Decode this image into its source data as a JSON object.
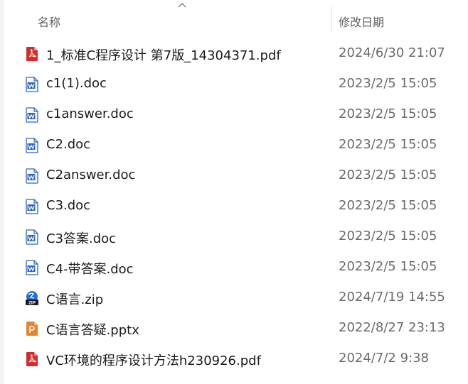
{
  "header": {
    "name_label": "名称",
    "date_label": "修改日期"
  },
  "colors": {
    "pdf": "#d42b2b",
    "doc": "#2b65c8",
    "ppt": "#e8832b",
    "zip": "#1e6fd0"
  },
  "files": [
    {
      "name": "1_标准C程序设计 第7版_14304371.pdf",
      "date": "2024/6/30 21:07",
      "icon": "pdf-icon"
    },
    {
      "name": "c1(1).doc",
      "date": "2023/2/5 15:05",
      "icon": "word-doc-icon"
    },
    {
      "name": "c1answer.doc",
      "date": "2023/2/5 15:05",
      "icon": "word-doc-icon"
    },
    {
      "name": "C2.doc",
      "date": "2023/2/5 15:05",
      "icon": "word-doc-icon"
    },
    {
      "name": "C2answer.doc",
      "date": "2023/2/5 15:05",
      "icon": "word-doc-icon"
    },
    {
      "name": "C3.doc",
      "date": "2023/2/5 15:05",
      "icon": "word-doc-icon"
    },
    {
      "name": "C3答案.doc",
      "date": "2023/2/5 15:05",
      "icon": "word-doc-icon"
    },
    {
      "name": "C4-带答案.doc",
      "date": "2023/2/5 15:05",
      "icon": "word-doc-icon"
    },
    {
      "name": "C语言.zip",
      "date": "2024/7/19 14:55",
      "icon": "zip-icon",
      "icon_text": "ZIP"
    },
    {
      "name": "C语言答疑.pptx",
      "date": "2022/8/27 23:13",
      "icon": "pptx-icon"
    },
    {
      "name": "VC环境的程序设计方法h230926.pdf",
      "date": "2024/7/2 9:38",
      "icon": "pdf-icon"
    }
  ]
}
